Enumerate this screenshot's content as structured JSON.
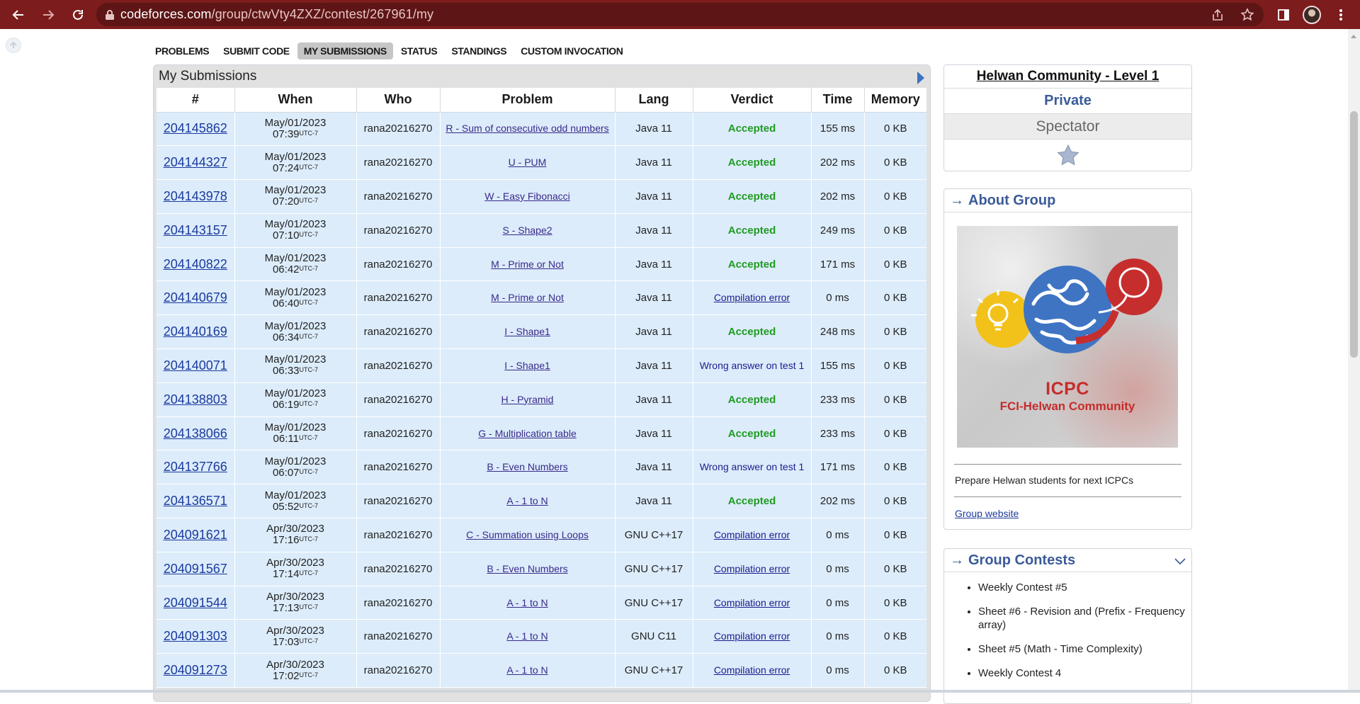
{
  "browser": {
    "url_host": "codeforces.com",
    "url_path": "/group/ctwVty4ZXZ/contest/267961/my"
  },
  "menu": [
    {
      "label": "PROBLEMS",
      "active": false
    },
    {
      "label": "SUBMIT CODE",
      "active": false
    },
    {
      "label": "MY SUBMISSIONS",
      "active": true
    },
    {
      "label": "STATUS",
      "active": false
    },
    {
      "label": "STANDINGS",
      "active": false
    },
    {
      "label": "CUSTOM INVOCATION",
      "active": false
    }
  ],
  "submissions": {
    "title": "My Submissions",
    "columns": [
      "#",
      "When",
      "Who",
      "Problem",
      "Lang",
      "Verdict",
      "Time",
      "Memory"
    ],
    "rows": [
      {
        "id": "204145862",
        "when_date": "May/01/2023",
        "when_time": "07:39",
        "tz": "UTC-7",
        "who": "rana20216270",
        "problem": "R - Sum of consecutive odd numbers",
        "lang": "Java 11",
        "verdict": "Accepted",
        "vtype": "ok",
        "time": "155 ms",
        "memory": "0 KB"
      },
      {
        "id": "204144327",
        "when_date": "May/01/2023",
        "when_time": "07:24",
        "tz": "UTC-7",
        "who": "rana20216270",
        "problem": "U - PUM",
        "lang": "Java 11",
        "verdict": "Accepted",
        "vtype": "ok",
        "time": "202 ms",
        "memory": "0 KB"
      },
      {
        "id": "204143978",
        "when_date": "May/01/2023",
        "when_time": "07:20",
        "tz": "UTC-7",
        "who": "rana20216270",
        "problem": "W - Easy Fibonacci",
        "lang": "Java 11",
        "verdict": "Accepted",
        "vtype": "ok",
        "time": "202 ms",
        "memory": "0 KB"
      },
      {
        "id": "204143157",
        "when_date": "May/01/2023",
        "when_time": "07:10",
        "tz": "UTC-7",
        "who": "rana20216270",
        "problem": "S - Shape2",
        "lang": "Java 11",
        "verdict": "Accepted",
        "vtype": "ok",
        "time": "249 ms",
        "memory": "0 KB"
      },
      {
        "id": "204140822",
        "when_date": "May/01/2023",
        "when_time": "06:42",
        "tz": "UTC-7",
        "who": "rana20216270",
        "problem": "M - Prime or Not",
        "lang": "Java 11",
        "verdict": "Accepted",
        "vtype": "ok",
        "time": "171 ms",
        "memory": "0 KB"
      },
      {
        "id": "204140679",
        "when_date": "May/01/2023",
        "when_time": "06:40",
        "tz": "UTC-7",
        "who": "rana20216270",
        "problem": "M - Prime or Not",
        "lang": "Java 11",
        "verdict": "Compilation error",
        "vtype": "ce",
        "time": "0 ms",
        "memory": "0 KB"
      },
      {
        "id": "204140169",
        "when_date": "May/01/2023",
        "when_time": "06:34",
        "tz": "UTC-7",
        "who": "rana20216270",
        "problem": "I - Shape1",
        "lang": "Java 11",
        "verdict": "Accepted",
        "vtype": "ok",
        "time": "248 ms",
        "memory": "0 KB"
      },
      {
        "id": "204140071",
        "when_date": "May/01/2023",
        "when_time": "06:33",
        "tz": "UTC-7",
        "who": "rana20216270",
        "problem": "I - Shape1",
        "lang": "Java 11",
        "verdict": "Wrong answer on test 1",
        "vtype": "wa",
        "time": "155 ms",
        "memory": "0 KB"
      },
      {
        "id": "204138803",
        "when_date": "May/01/2023",
        "when_time": "06:19",
        "tz": "UTC-7",
        "who": "rana20216270",
        "problem": "H - Pyramid",
        "lang": "Java 11",
        "verdict": "Accepted",
        "vtype": "ok",
        "time": "233 ms",
        "memory": "0 KB"
      },
      {
        "id": "204138066",
        "when_date": "May/01/2023",
        "when_time": "06:11",
        "tz": "UTC-7",
        "who": "rana20216270",
        "problem": "G - Multiplication table",
        "lang": "Java 11",
        "verdict": "Accepted",
        "vtype": "ok",
        "time": "233 ms",
        "memory": "0 KB"
      },
      {
        "id": "204137766",
        "when_date": "May/01/2023",
        "when_time": "06:07",
        "tz": "UTC-7",
        "who": "rana20216270",
        "problem": "B - Even Numbers",
        "lang": "Java 11",
        "verdict": "Wrong answer on test 1",
        "vtype": "wa",
        "time": "171 ms",
        "memory": "0 KB"
      },
      {
        "id": "204136571",
        "when_date": "May/01/2023",
        "when_time": "05:52",
        "tz": "UTC-7",
        "who": "rana20216270",
        "problem": "A - 1 to N",
        "lang": "Java 11",
        "verdict": "Accepted",
        "vtype": "ok",
        "time": "202 ms",
        "memory": "0 KB"
      },
      {
        "id": "204091621",
        "when_date": "Apr/30/2023",
        "when_time": "17:16",
        "tz": "UTC-7",
        "who": "rana20216270",
        "problem": "C - Summation using Loops",
        "lang": "GNU C++17",
        "verdict": "Compilation error",
        "vtype": "ce",
        "time": "0 ms",
        "memory": "0 KB"
      },
      {
        "id": "204091567",
        "when_date": "Apr/30/2023",
        "when_time": "17:14",
        "tz": "UTC-7",
        "who": "rana20216270",
        "problem": "B - Even Numbers",
        "lang": "GNU C++17",
        "verdict": "Compilation error",
        "vtype": "ce",
        "time": "0 ms",
        "memory": "0 KB"
      },
      {
        "id": "204091544",
        "when_date": "Apr/30/2023",
        "when_time": "17:13",
        "tz": "UTC-7",
        "who": "rana20216270",
        "problem": "A - 1 to N",
        "lang": "GNU C++17",
        "verdict": "Compilation error",
        "vtype": "ce",
        "time": "0 ms",
        "memory": "0 KB"
      },
      {
        "id": "204091303",
        "when_date": "Apr/30/2023",
        "when_time": "17:03",
        "tz": "UTC-7",
        "who": "rana20216270",
        "problem": "A - 1 to N",
        "lang": "GNU C11",
        "verdict": "Compilation error",
        "vtype": "ce",
        "time": "0 ms",
        "memory": "0 KB"
      },
      {
        "id": "204091273",
        "when_date": "Apr/30/2023",
        "when_time": "17:02",
        "tz": "UTC-7",
        "who": "rana20216270",
        "problem": "A - 1 to N",
        "lang": "GNU C++17",
        "verdict": "Compilation error",
        "vtype": "ce",
        "time": "0 ms",
        "memory": "0 KB"
      }
    ]
  },
  "sidebar": {
    "contest_name": "Helwan Community - Level 1",
    "contest_type": "Private",
    "contest_phase": "Spectator",
    "about": {
      "title": "About Group",
      "logo_line1": "ICPC",
      "logo_line2": "FCI-Helwan Community",
      "description": "Prepare Helwan students for next ICPCs",
      "website_label": "Group website"
    },
    "contests": {
      "title": "Group Contests",
      "items": [
        "Weekly Contest #5",
        "Sheet #6 - Revision and (Prefix - Frequency array)",
        "Sheet #5 (Math - Time Complexity)",
        "Weekly Contest 4"
      ]
    }
  },
  "colors": {
    "chrome": "#7d1c1c",
    "accepted": "#1f9b21",
    "link": "#1b3a9e",
    "row_bg": "#dcecfb",
    "sidebar_head": "#3b5b98"
  }
}
